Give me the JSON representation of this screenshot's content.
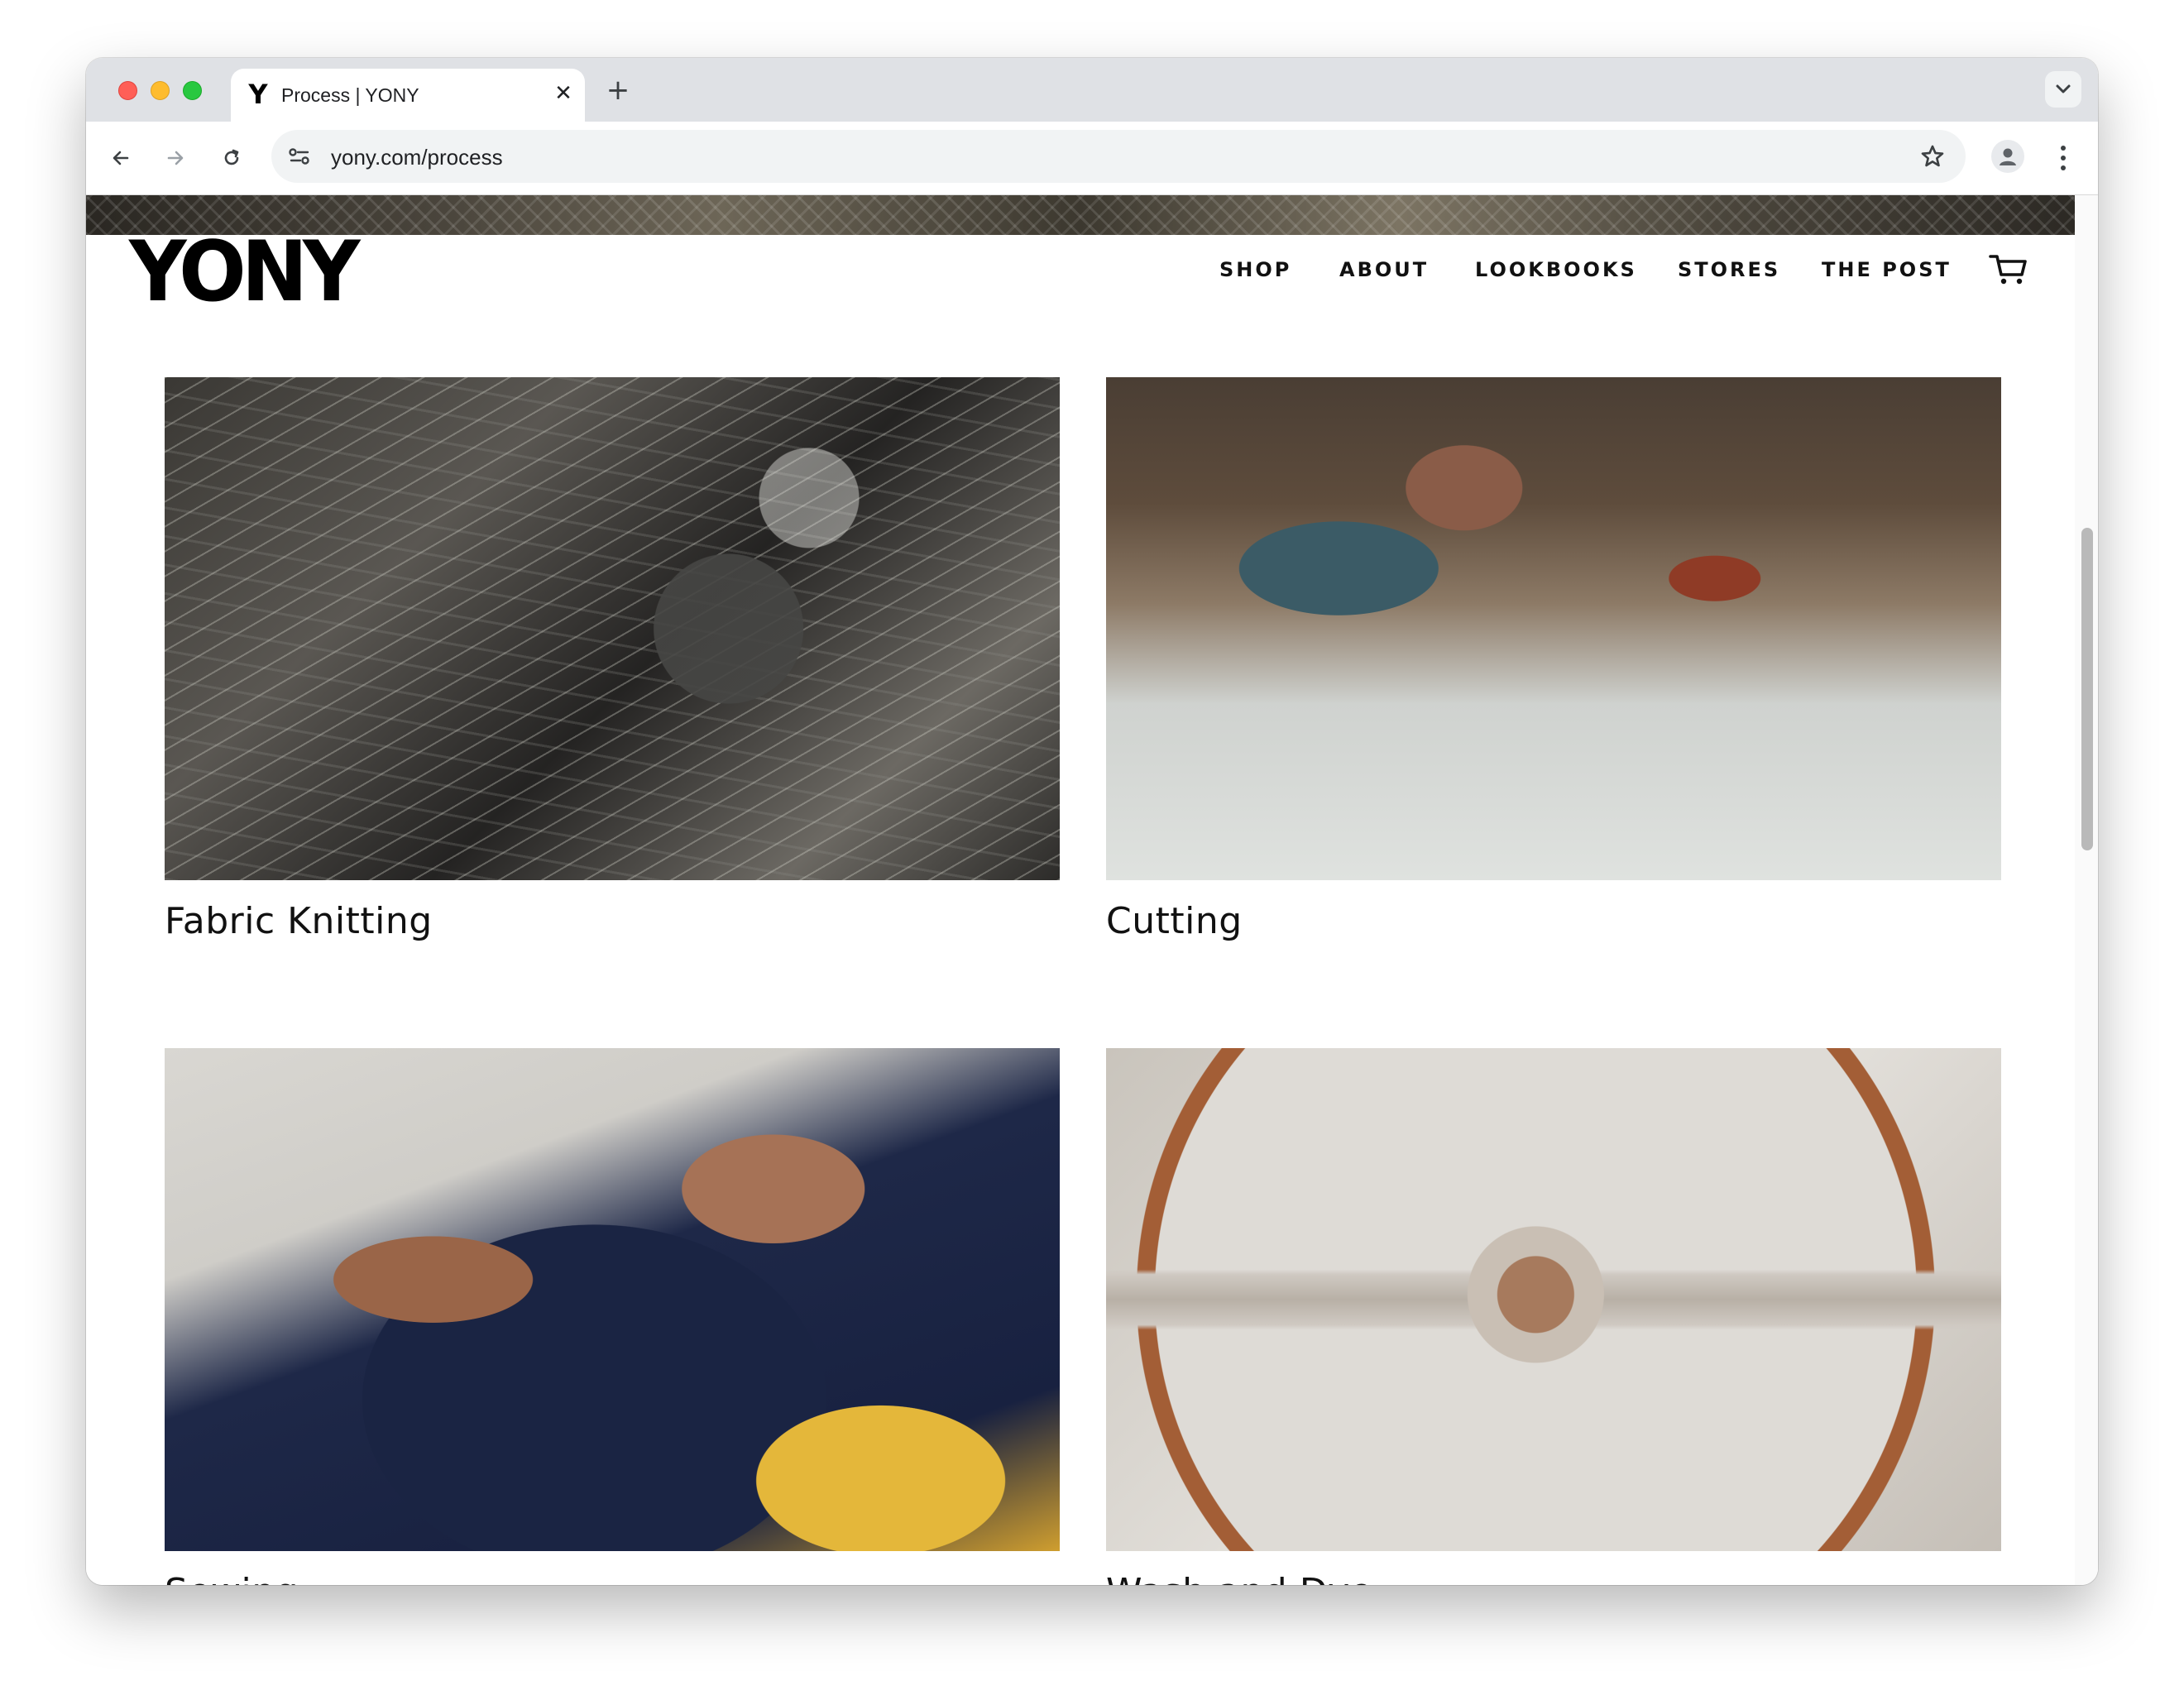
{
  "browser": {
    "tab_title": "Process | YONY",
    "tab_favicon": "Y",
    "close_glyph": "✕",
    "new_tab_glyph": "+",
    "url": "yony.com/process"
  },
  "site": {
    "logo": "YONY",
    "nav": [
      "SHOP",
      "ABOUT",
      "LOOKBOOKS",
      "STORES",
      "THE POST"
    ]
  },
  "process_steps": [
    {
      "title": "Fabric Knitting",
      "image": "fabric-knitting-machine"
    },
    {
      "title": "Cutting",
      "image": "fabric-cutting-worker"
    },
    {
      "title": "Sewing",
      "image": "sewing-zipper-hands"
    },
    {
      "title": "Wash and Dye",
      "image": "wash-dye-drum-lid"
    }
  ],
  "icons": [
    "back-icon",
    "forward-icon",
    "reload-icon",
    "site-settings-icon",
    "bookmark-star-icon",
    "profile-icon",
    "kebab-menu-icon",
    "tab-search-chevron-icon",
    "cart-icon"
  ],
  "colors": {
    "tabbar": "#dfe1e5",
    "accent_text": "#111111"
  }
}
